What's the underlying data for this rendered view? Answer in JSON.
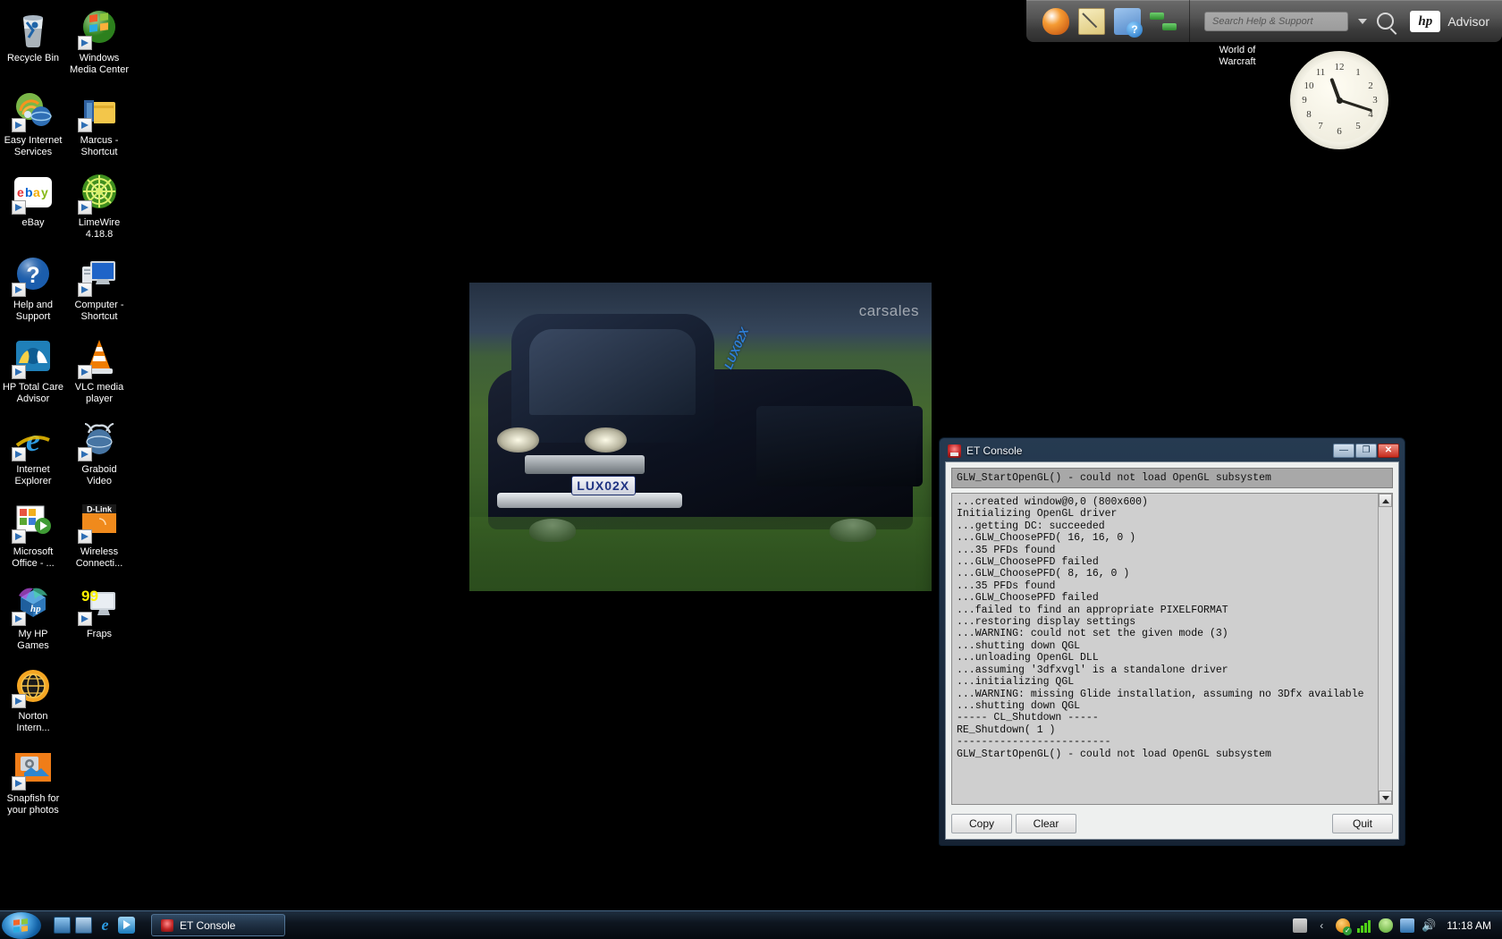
{
  "desktop": {
    "icons": [
      {
        "label": "Recycle Bin",
        "icon": "recycle-bin-icon",
        "shortcut": false
      },
      {
        "label": "Windows Media Center",
        "icon": "windows-media-center-icon",
        "shortcut": true
      },
      {
        "label": "Easy Internet Services",
        "icon": "easy-internet-services-icon",
        "shortcut": true
      },
      {
        "label": "Marcus - Shortcut",
        "icon": "folder-icon",
        "shortcut": true
      },
      {
        "label": "eBay",
        "icon": "ebay-icon",
        "shortcut": true
      },
      {
        "label": "LimeWire 4.18.8",
        "icon": "limewire-icon",
        "shortcut": true
      },
      {
        "label": "Help and Support",
        "icon": "help-and-support-icon",
        "shortcut": true
      },
      {
        "label": "Computer - Shortcut",
        "icon": "computer-icon",
        "shortcut": true
      },
      {
        "label": "HP Total Care Advisor",
        "icon": "hp-total-care-advisor-icon",
        "shortcut": true
      },
      {
        "label": "VLC media player",
        "icon": "vlc-cone-icon",
        "shortcut": true
      },
      {
        "label": "Internet Explorer",
        "icon": "internet-explorer-icon",
        "shortcut": true
      },
      {
        "label": "Graboid Video",
        "icon": "graboid-video-icon",
        "shortcut": true
      },
      {
        "label": "Microsoft Office - ...",
        "icon": "microsoft-office-icon",
        "shortcut": true
      },
      {
        "label": "Wireless Connecti...",
        "icon": "dlink-wireless-icon",
        "shortcut": true
      },
      {
        "label": "My HP Games",
        "icon": "my-hp-games-icon",
        "shortcut": true
      },
      {
        "label": "Fraps",
        "icon": "fraps-icon",
        "shortcut": true
      },
      {
        "label": "Norton Intern...",
        "icon": "norton-internet-security-icon",
        "shortcut": true
      },
      {
        "label": "Snapfish for your photos",
        "icon": "snapfish-icon",
        "shortcut": true
      }
    ],
    "wow_shortcut": {
      "label": "World of Warcraft"
    },
    "wallpaper": {
      "watermark": "carsales",
      "plate": "LUX02X",
      "windscreen_text": "LUX02X"
    }
  },
  "hp_dock": {
    "icons": [
      {
        "name": "hp-shield-icon"
      },
      {
        "name": "notepad-icon"
      },
      {
        "name": "help-book-icon"
      },
      {
        "name": "file-transfer-icon"
      }
    ],
    "search": {
      "placeholder": "Search Help & Support",
      "value": ""
    },
    "brand_logo": "hp",
    "brand_text": "Advisor"
  },
  "clock_gadget": {
    "numbers": [
      "12",
      "1",
      "2",
      "3",
      "4",
      "5",
      "6",
      "7",
      "8",
      "9",
      "10",
      "11"
    ],
    "time": "11:18"
  },
  "et_console": {
    "title": "ET Console",
    "window_buttons": {
      "minimize": "—",
      "maximize": "❐",
      "close": "✕"
    },
    "status_line": "GLW_StartOpenGL() - could not load OpenGL subsystem",
    "log": "...created window@0,0 (800x600)\nInitializing OpenGL driver\n...getting DC: succeeded\n...GLW_ChoosePFD( 16, 16, 0 )\n...35 PFDs found\n...GLW_ChoosePFD failed\n...GLW_ChoosePFD( 8, 16, 0 )\n...35 PFDs found\n...GLW_ChoosePFD failed\n...failed to find an appropriate PIXELFORMAT\n...restoring display settings\n...WARNING: could not set the given mode (3)\n...shutting down QGL\n...unloading OpenGL DLL\n...assuming '3dfxvgl' is a standalone driver\n...initializing QGL\n...WARNING: missing Glide installation, assuming no 3Dfx available\n...shutting down QGL\n----- CL_Shutdown -----\nRE_Shutdown( 1 )\n-------------------------\nGLW_StartOpenGL() - could not load OpenGL subsystem",
    "buttons": {
      "copy": "Copy",
      "clear": "Clear",
      "quit": "Quit"
    }
  },
  "taskbar": {
    "start_label": "Start",
    "quicklaunch": [
      {
        "name": "show-desktop-icon"
      },
      {
        "name": "switch-windows-icon"
      },
      {
        "name": "internet-explorer-icon",
        "glyph": "e"
      },
      {
        "name": "windows-media-player-icon"
      }
    ],
    "tasks": [
      {
        "label": "ET Console"
      }
    ],
    "tray": {
      "icons": [
        {
          "name": "keyboard-icon"
        },
        {
          "name": "show-hidden-icons-chevron"
        },
        {
          "name": "norton-icon"
        },
        {
          "name": "wireless-signal-icon"
        },
        {
          "name": "user-account-icon"
        },
        {
          "name": "network-icon"
        },
        {
          "name": "volume-icon",
          "glyph": "🔊"
        }
      ],
      "clock": "11:18 AM"
    }
  },
  "colors": {
    "desktop_bg": "#000000",
    "taskbar": "#0e1620",
    "accent": "#2f6fb5",
    "console_bg": "#cfcfcf"
  }
}
